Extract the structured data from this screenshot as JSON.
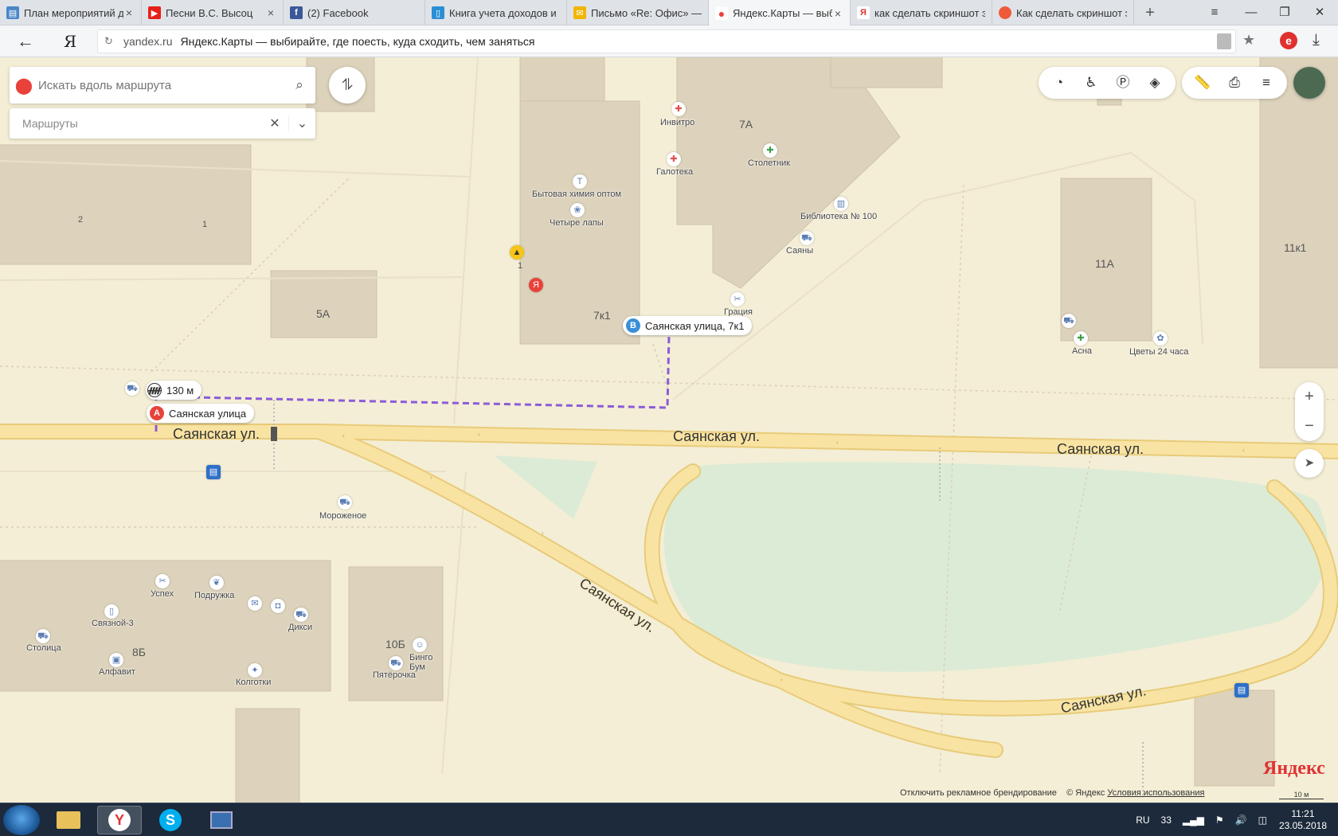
{
  "browser": {
    "tabs": [
      {
        "title": "План мероприятий для",
        "icon": "document-icon",
        "color": "#4a86c8",
        "glyph": "▤"
      },
      {
        "title": "Песни В.С. Высоц",
        "icon": "youtube-icon",
        "color": "#e62117",
        "glyph": "▶"
      },
      {
        "title": "(2) Facebook",
        "icon": "facebook-icon",
        "color": "#3b5998",
        "glyph": "f"
      },
      {
        "title": "Книга учета доходов и р",
        "icon": "book-icon",
        "color": "#2b8fd6",
        "glyph": "▯"
      },
      {
        "title": "Письмо «Re: Офис» — Г",
        "icon": "mail-icon",
        "color": "#f2b500",
        "glyph": "✉"
      },
      {
        "title": "Яндекс.Карты — выб",
        "icon": "map-pin-icon",
        "color": "#e8423a",
        "glyph": "●"
      },
      {
        "title": "как сделать скриншот э",
        "icon": "yandex-icon",
        "color": "#e03333",
        "glyph": "Я"
      },
      {
        "title": "Как сделать скриншот э",
        "icon": "red-circle-icon",
        "color": "#ef5a3a",
        "glyph": "●"
      }
    ],
    "active_tab": 5,
    "new_tab": "+",
    "url_domain": "yandex.ru",
    "page_title": "Яндекс.Карты — выбирайте, где поесть, куда сходить, чем заняться",
    "yandex_letter": "Я"
  },
  "map": {
    "search_placeholder": "Искать вдоль маршрута",
    "routes_placeholder": "Маршруты",
    "route_a": {
      "letter": "A",
      "label": "Саянская улица"
    },
    "route_b": {
      "letter": "B",
      "label": "Саянская улица, 7к1"
    },
    "walk_distance": "130 м",
    "streets": [
      "Саянская ул.",
      "Саянская ул.",
      "Саянская ул.",
      "Саянская ул.",
      "Саянская ул."
    ],
    "buildings": [
      "7А",
      "5А",
      "7к1",
      "11А",
      "11к1",
      "8Б",
      "10Б",
      "2",
      "1",
      "1"
    ],
    "pois": [
      "Инвитро",
      "Галотека",
      "Столетник",
      "Бытовая химия оптом",
      "Четыре лапы",
      "Библиотека № 100",
      "Саяны",
      "Грация",
      "Асна",
      "Цветы 24 часа",
      "Мороженое",
      "Успех",
      "Подружка",
      "Связной-3",
      "Дикси",
      "Столица",
      "Алфавит",
      "Колготки",
      "Бинго Бум",
      "Пятёрочка"
    ],
    "footer_disable": "Отключить рекламное брендирование",
    "footer_copyright": "© Яндекс",
    "footer_terms": "Условия использования",
    "brand": "Яндекс",
    "scale": "10 м",
    "zoom_in": "+",
    "zoom_out": "−"
  },
  "taskbar": {
    "lang": "RU",
    "battery": "33",
    "time": "11:21",
    "date": "23.05.2018"
  },
  "colors": {
    "map_bg": "#f4eed6",
    "building": "#ddd3bc",
    "road": "#f8e3a3",
    "park": "#dcebd5",
    "route": "#8c5bd8"
  }
}
